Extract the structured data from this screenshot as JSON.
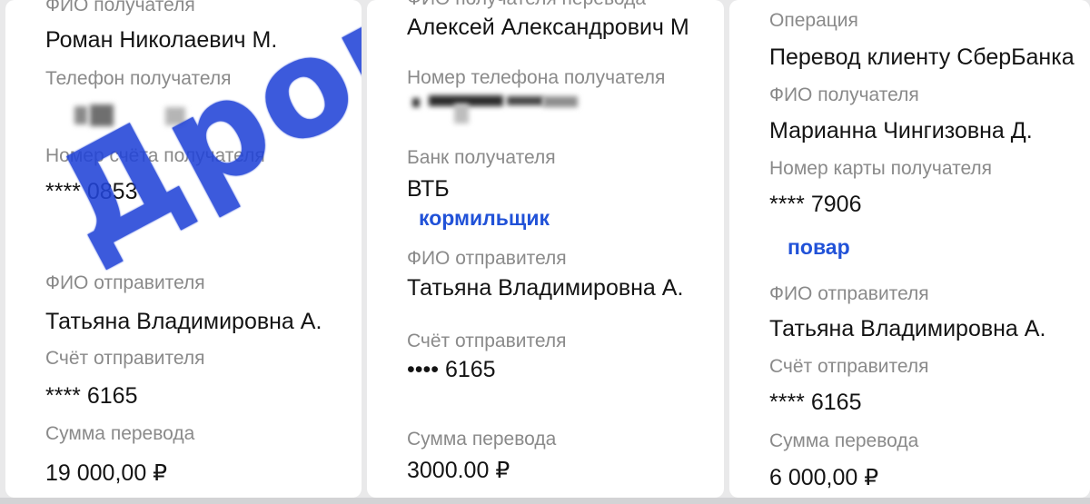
{
  "receipt1": {
    "recipient_name_label": "ФИО получателя",
    "recipient_name": "Роман Николаевич М.",
    "recipient_phone_label": "Телефон получателя",
    "recipient_account_label": "Номер счёта получателя",
    "recipient_account": "**** 0853",
    "sender_name_label": "ФИО отправителя",
    "sender_name": "Татьяна Владимировна А.",
    "sender_account_label": "Счёт отправителя",
    "sender_account": "**** 6165",
    "amount_label": "Сумма перевода",
    "amount": "19 000,00 ₽",
    "stamp": "Дрова"
  },
  "receipt2": {
    "recipient_name_label": "ФИО получателя перевода",
    "recipient_name": "Алексей Александрович М",
    "recipient_phone_label": "Номер телефона получателя",
    "bank_label": "Банк получателя",
    "bank": "ВТБ",
    "note": "кормильщик",
    "sender_name_label": "ФИО отправителя",
    "sender_name": "Татьяна Владимировна А.",
    "sender_account_label": "Счёт отправителя",
    "sender_account": "•••• 6165",
    "amount_label": "Сумма перевода",
    "amount": "3000.00 ₽"
  },
  "receipt3": {
    "operation_label": "Операция",
    "operation": "Перевод клиенту СберБанка",
    "recipient_name_label": "ФИО получателя",
    "recipient_name": "Марианна Чингизовна Д.",
    "recipient_card_label": "Номер карты получателя",
    "recipient_card": "**** 7906",
    "note": "повар",
    "sender_name_label": "ФИО отправителя",
    "sender_name": "Татьяна Владимировна А.",
    "sender_account_label": "Счёт отправителя",
    "sender_account": "**** 6165",
    "amount_label": "Сумма перевода",
    "amount": "6 000,00 ₽"
  }
}
